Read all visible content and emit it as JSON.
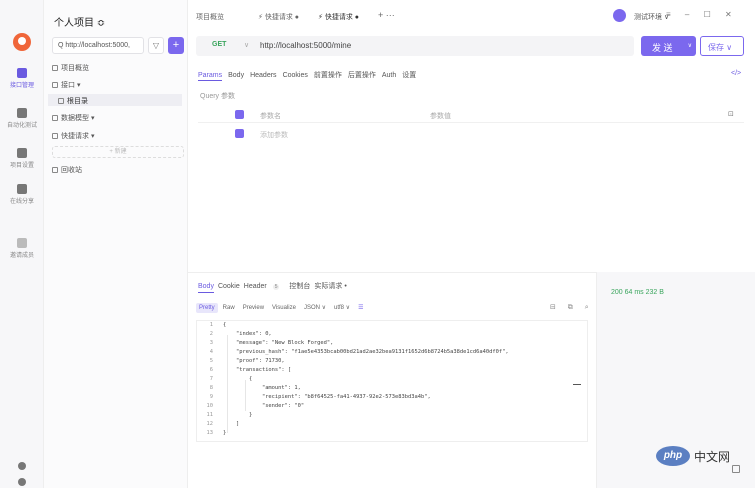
{
  "rail": {
    "items": [
      {
        "label": "接口管理"
      },
      {
        "label": "自动化测试"
      },
      {
        "label": "项目设置"
      },
      {
        "label": "在线分享"
      },
      {
        "label": "邀请成员"
      }
    ]
  },
  "sidebar": {
    "project_name": "个人项目 ≎",
    "search_value": "Q  http://localhost:5000,",
    "filter_icon": "filter-icon",
    "add_label": "+",
    "tree": [
      {
        "label": "项目概览"
      },
      {
        "label": "接口 ▾"
      },
      {
        "label": "根目录"
      },
      {
        "label": "数据模型 ▾"
      },
      {
        "label": "快捷请求 ▾"
      },
      {
        "label": "回收站"
      }
    ],
    "new_label": "+ 新建"
  },
  "topbar": {
    "tabs": [
      {
        "label": "项目概览"
      },
      {
        "label": "⚡ 快捷请求 ●"
      },
      {
        "label": "⚡ 快捷请求 ●"
      },
      {
        "label": "+   ···"
      }
    ],
    "env_label": "测试环境  ∨",
    "window_controls": "≡  – ☐ ✕"
  },
  "request": {
    "method": "GET",
    "method_color": "#3aa55d",
    "caret": "∨",
    "url": "http://localhost:5000/mine",
    "send_label": "发 送",
    "send_caret": "∨",
    "save_label": "保存 ∨",
    "accent_color": "#7b68ee",
    "tabs": [
      "Params",
      "Body",
      "Headers",
      "Cookies",
      "前置操作",
      "后置操作",
      "Auth",
      "设置"
    ],
    "code_icon": "</>",
    "query_label": "Query 参数",
    "col_name": "参数名",
    "col_value": "参数值",
    "add_param_placeholder": "添加参数",
    "bulk_icon": "bulk-edit-icon"
  },
  "response": {
    "tabs": [
      {
        "label": "Body"
      },
      {
        "label": "Cookie"
      },
      {
        "label": "Header"
      },
      {
        "label": "控制台"
      },
      {
        "label": "实际请求 •"
      }
    ],
    "header_count": "5",
    "options": [
      "Pretty",
      "Raw",
      "Preview",
      "Visualize",
      "JSON ∨",
      "utf8 ∨",
      "☰"
    ],
    "icons": "⊟  ⧉  ⌕",
    "status_text": "200   64 ms   232 B",
    "code_lines": [
      {
        "n": "1",
        "t": "{"
      },
      {
        "n": "2",
        "t": "    \"index\": 0,"
      },
      {
        "n": "3",
        "t": "    \"message\": \"New Block Forged\","
      },
      {
        "n": "4",
        "t": "    \"previous_hash\": \"f1ae5e4353bcab00bd21ad2ae32bea9131f1652d6b8724b5a38de1cd6a40df0f\","
      },
      {
        "n": "5",
        "t": "    \"proof\": 71730,"
      },
      {
        "n": "6",
        "t": "    \"transactions\": ["
      },
      {
        "n": "7",
        "t": "        {"
      },
      {
        "n": "8",
        "t": "            \"amount\": 1,"
      },
      {
        "n": "9",
        "t": "            \"recipient\": \"b8f64525-fa41-4937-92e2-573e83bd3a4b\","
      },
      {
        "n": "10",
        "t": "            \"sender\": \"0\""
      },
      {
        "n": "11",
        "t": "        }"
      },
      {
        "n": "12",
        "t": "    ]"
      },
      {
        "n": "13",
        "t": "}"
      }
    ]
  },
  "watermark": {
    "logo": "php",
    "text": "中文网"
  }
}
